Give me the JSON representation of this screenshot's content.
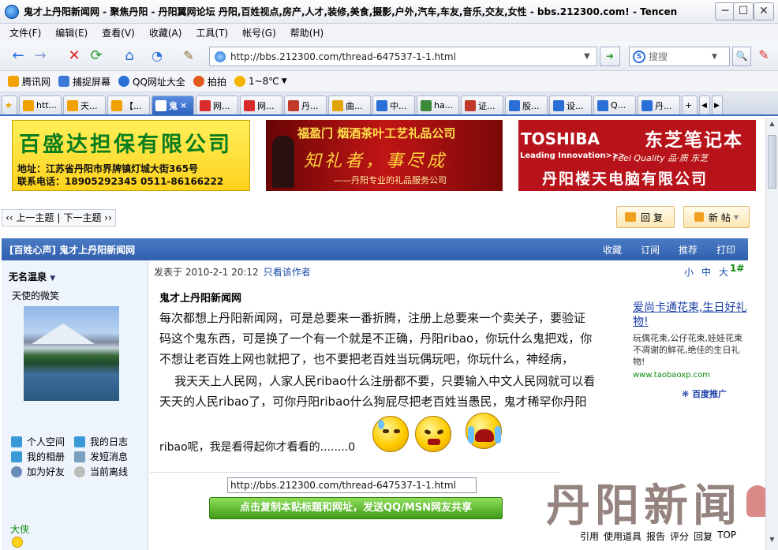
{
  "window": {
    "title": "鬼才上丹阳新闻网 - 聚焦丹阳 - 丹阳翼网论坛 丹阳,百姓视点,房产,人才,装修,美食,摄影,户外,汽车,车友,音乐,交友,女性 - bbs.212300.com! - Tencen",
    "min": "─",
    "max": "☐",
    "close": "✕"
  },
  "menu": [
    "文件(F)",
    "编辑(E)",
    "查看(V)",
    "收藏(A)",
    "工具(T)",
    "帐号(G)",
    "帮助(H)"
  ],
  "nav": {
    "back": "←",
    "forward": "→",
    "stop": "✕",
    "refresh": "⟳",
    "home": "⌂",
    "url": "http://bbs.212300.com/thread-647537-1-1.html",
    "go": "➜",
    "search_placeholder": "搜搜",
    "search_btn": "🔍"
  },
  "favorites": [
    {
      "label": "腾讯网",
      "color": "#f2a100"
    },
    {
      "label": "捕捉屏幕",
      "color": "#3b78d8"
    },
    {
      "label": "QQ网址大全",
      "color": "#2a6fd8"
    },
    {
      "label": "拍拍",
      "color": "#e25b1c"
    },
    {
      "label": "1~8℃",
      "color": "#f5b400"
    }
  ],
  "tabs": [
    {
      "label": "htt...",
      "color": "#f2a100"
    },
    {
      "label": "天...",
      "color": "#f2a100"
    },
    {
      "label": "【...",
      "color": "#f2a100"
    },
    {
      "label": "鬼",
      "color": "#c0392b",
      "active": true
    },
    {
      "label": "网...",
      "color": "#d92b2b"
    },
    {
      "label": "网...",
      "color": "#d92b2b"
    },
    {
      "label": "丹...",
      "color": "#c0392b"
    },
    {
      "label": "曲...",
      "color": "#e2a400"
    },
    {
      "label": "中...",
      "color": "#2a6fd8"
    },
    {
      "label": "ha...",
      "color": "#3a8a3a"
    },
    {
      "label": "证...",
      "color": "#c0392b"
    },
    {
      "label": "股...",
      "color": "#2a6fd8"
    },
    {
      "label": "设...",
      "color": "#2a6fd8"
    },
    {
      "label": "Q...",
      "color": "#2a6fd8"
    },
    {
      "label": "丹...",
      "color": "#2a6fd8"
    }
  ],
  "ads": {
    "ad1": {
      "name": "百盛达担保有限公司",
      "line1": "地址：江苏省丹阳市界牌镇灯城大街365号",
      "line2": "联系电话：18905292345   0511-86166222"
    },
    "ad2": {
      "line1": "福盈门 烟酒茶叶工艺礼品公司",
      "line2": "知礼者，事尽成",
      "line3": "——丹阳专业的礼品服务公司"
    },
    "ad3": {
      "brand": "TOSHIBA",
      "sub": "Leading Innovation>>>",
      "cn": "东芝笔记本",
      "fq": "Feel Quality 品·质 东芝",
      "company": "丹阳楼天电脑有限公司"
    }
  },
  "thread": {
    "prev": "‹‹ 上一主题",
    "sep": "|",
    "next": "下一主题 ››",
    "reply": "回复",
    "newpost": "新帖",
    "header": "[百姓心声] 鬼才上丹阳新闻网",
    "actions": [
      "收藏",
      "订阅",
      "推荐",
      "打印"
    ]
  },
  "author": {
    "name": "无名温泉",
    "motto": "天使的微笑",
    "rank": "大侠",
    "links": [
      "个人空间",
      "我的日志",
      "我的相册",
      "发短消息",
      "加为好友",
      "当前离线"
    ]
  },
  "post": {
    "posted": "发表于 2010-2-1 20:12",
    "only_author": "只看该作者",
    "sizes": [
      "小",
      "中",
      "大"
    ],
    "floor": "1#",
    "title": "鬼才上丹阳新闻网",
    "lines": [
      "每次都想上丹阳新闻网，可是总要来一番折腾，注册上总要来一个卖关子，要验证",
      "码这个鬼东西，可是换了一个有一个就是不正确，丹阳ribao，你玩什么鬼把戏，你",
      "不想让老百姓上网也就把了，也不要把老百姓当玩偶玩吧，你玩什么，神经病，",
      "    我天天上人民网，人家人民ribao什么注册都不要，只要输入中文人民网就可以看",
      "天天的人民ribao了，可你丹阳ribao什么狗屁尽把老百姓当愚民，鬼才稀罕你丹阳",
      "ribao呢，我是看得起你才看看的........0"
    ]
  },
  "side_ad": {
    "headline": "爱尚卡通花束,生日好礼物!",
    "desc": "玩偶花束,公仔花束,娃娃花束 不凋谢的鲜花,绝佳的生日礼物!",
    "url": "www.taobaoxp.com",
    "baidu": "百度推广"
  },
  "share": {
    "url": "http://bbs.212300.com/thread-647537-1-1.html",
    "button": "点击复制本贴标题和网址，发送QQ/MSN网友共享"
  },
  "bottom_actions": [
    "引用",
    "使用道具",
    "报告",
    "评分",
    "回复",
    "TOP"
  ],
  "watermark": "丹阳新闻"
}
